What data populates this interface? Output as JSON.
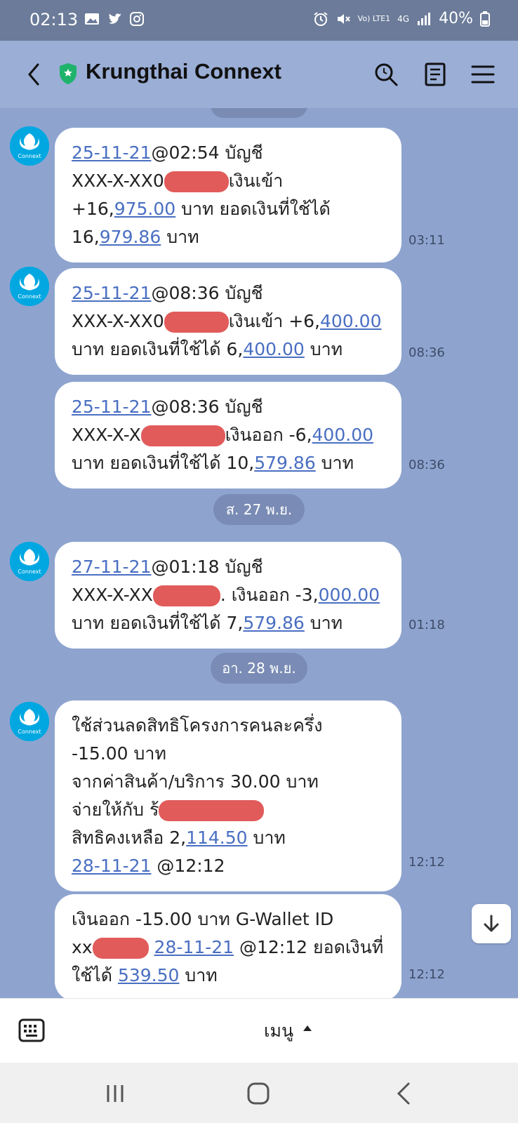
{
  "status_bar": {
    "time": "02:13",
    "network_label": "Vo) LTE1",
    "network_type": "4G",
    "battery": "40%",
    "icons": [
      "gallery-icon",
      "twitter-icon",
      "instagram-icon",
      "alarm-icon",
      "mute-icon",
      "signal-icon",
      "battery-icon"
    ]
  },
  "header": {
    "title": "Krungthai Connext",
    "icons": [
      "back-icon",
      "shield-icon",
      "search-icon",
      "notes-icon",
      "menu-icon"
    ]
  },
  "messages": [
    {
      "lines": [
        [
          {
            "t": "25-11-21",
            "link": true
          },
          {
            "t": "@02:54 บัญชี"
          }
        ],
        [
          {
            "t": "XXX-X-XX0"
          },
          {
            "redact": 1
          },
          {
            "t": "เงินเข้า"
          }
        ],
        [
          {
            "t": "+16,"
          },
          {
            "t": "975.00",
            "link": true
          },
          {
            "t": " บาท ยอดเงินที่ใช้ได้"
          }
        ],
        [
          {
            "t": "16,"
          },
          {
            "t": "979.86",
            "link": true
          },
          {
            "t": " บาท"
          }
        ]
      ],
      "time": "03:11",
      "avatar": true
    },
    {
      "lines": [
        [
          {
            "t": "25-11-21",
            "link": true
          },
          {
            "t": "@08:36 บัญชี"
          }
        ],
        [
          {
            "t": "XXX-X-XX0"
          },
          {
            "redact": 1
          },
          {
            "t": "เงินเข้า +6,"
          },
          {
            "t": "400.00",
            "link": true
          }
        ],
        [
          {
            "t": "บาท ยอดเงินที่ใช้ได้ 6,"
          },
          {
            "t": "400.00",
            "link": true
          },
          {
            "t": " บาท"
          }
        ]
      ],
      "time": "08:36",
      "avatar": true
    },
    {
      "lines": [
        [
          {
            "t": "25-11-21",
            "link": true
          },
          {
            "t": "@08:36 บัญชี"
          }
        ],
        [
          {
            "t": "XXX-X-X"
          },
          {
            "redact": 1
          },
          {
            "t": "เงินออก -6,"
          },
          {
            "t": "400.00",
            "link": true
          }
        ],
        [
          {
            "t": "บาท ยอดเงินที่ใช้ได้ 10,"
          },
          {
            "t": "579.86",
            "link": true
          },
          {
            "t": " บาท"
          }
        ]
      ],
      "time": "08:36",
      "avatar": false
    },
    {
      "lines": [
        [
          {
            "t": "27-11-21",
            "link": true
          },
          {
            "t": "@01:18 บัญชี"
          }
        ],
        [
          {
            "t": "XXX-X-XX"
          },
          {
            "redact": 1
          },
          {
            "t": ". เงินออก -3,"
          },
          {
            "t": "000.00",
            "link": true
          }
        ],
        [
          {
            "t": "บาท ยอดเงินที่ใช้ได้ 7,"
          },
          {
            "t": "579.86",
            "link": true
          },
          {
            "t": " บาท"
          }
        ]
      ],
      "time": "01:18",
      "avatar": true
    },
    {
      "lines": [
        [
          {
            "t": "ใช้ส่วนลดสิทธิโครงการคนละครึ่ง"
          }
        ],
        [
          {
            "t": "-15.00 บาท"
          }
        ],
        [
          {
            "t": "จากค่าสินค้า/บริการ 30.00 บาท"
          }
        ],
        [
          {
            "t": "จ่ายให้กับ ร้"
          },
          {
            "redact": 1
          }
        ],
        [
          {
            "t": "สิทธิคงเหลือ 2,"
          },
          {
            "t": "114.50",
            "link": true
          },
          {
            "t": " บาท"
          }
        ],
        [
          {
            "t": "28-11-21",
            "link": true
          },
          {
            "t": " @12:12"
          }
        ]
      ],
      "time": "12:12",
      "avatar": true
    },
    {
      "lines": [
        [
          {
            "t": "เงินออก -15.00 บาท G-Wallet ID"
          }
        ],
        [
          {
            "t": "xx"
          },
          {
            "redact": 1
          },
          {
            "t": " "
          },
          {
            "t": "28-11-21",
            "link": true
          },
          {
            "t": " @12:12 ยอดเงินที่"
          }
        ],
        [
          {
            "t": "ใช้ได้ "
          },
          {
            "t": "539.50",
            "link": true
          },
          {
            "t": " บาท"
          }
        ]
      ],
      "time": "12:12",
      "avatar": false
    }
  ],
  "date_separators": [
    "ส. 27 พ.ย.",
    "อา. 28 พ.ย."
  ],
  "menu_bar": {
    "label": "เมนู",
    "icons": [
      "keyboard-icon",
      "caret-up-icon"
    ]
  },
  "nav_bar": {
    "icons": [
      "recent-apps-icon",
      "home-icon",
      "back-nav-icon"
    ]
  },
  "colors": {
    "chat_background": "#8ea4cf",
    "header_background": "#9aaed6",
    "status_bar": "#6b7b99",
    "link": "#4a6fc2",
    "redaction": "#e15b5b"
  }
}
